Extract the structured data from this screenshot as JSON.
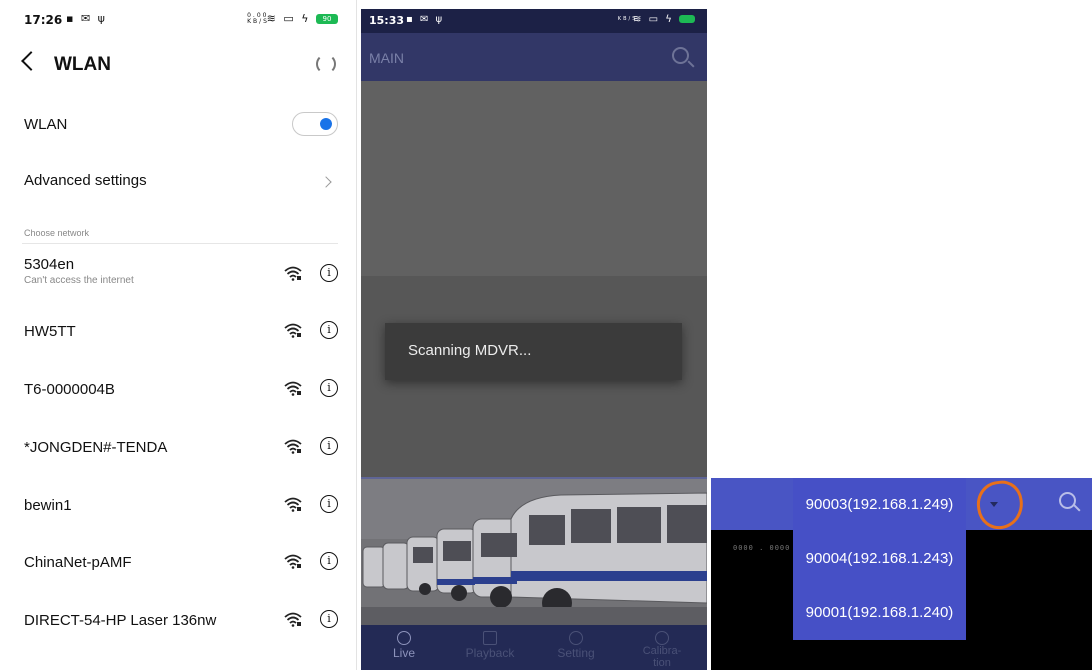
{
  "wlan_screen": {
    "status_bar": {
      "time": "17:26",
      "left_icons": "▪ ✉ ψ",
      "speed": "0.00 KB/S",
      "battery": "90"
    },
    "header": {
      "title": "WLAN"
    },
    "wlan_toggle": {
      "label": "WLAN",
      "state": "on"
    },
    "advanced": {
      "label": "Advanced settings"
    },
    "section_label": "Choose network",
    "networks": [
      {
        "name": "5304en",
        "status": "Can't access the internet"
      },
      {
        "name": "HW5TT",
        "status": ""
      },
      {
        "name": "T6-0000004B",
        "status": ""
      },
      {
        "name": "*JONGDEN#-TENDA",
        "status": ""
      },
      {
        "name": "bewin1",
        "status": ""
      },
      {
        "name": "ChinaNet-pAMF",
        "status": ""
      },
      {
        "name": "DIRECT-54-HP Laser 136nw",
        "status": ""
      }
    ]
  },
  "main_screen": {
    "status_bar": {
      "time": "15:33",
      "left_icons": "▪ ✉ ψ",
      "speed": "KB/S",
      "battery": ""
    },
    "appbar_title": "MAIN",
    "toast": "Scanning MDVR...",
    "nav": [
      {
        "label": "Live",
        "icon": "camera-icon"
      },
      {
        "label": "Playback",
        "icon": "image-icon"
      },
      {
        "label": "Setting",
        "icon": "gear-icon"
      },
      {
        "label": "Calibra- tion",
        "icon": "target-icon"
      }
    ]
  },
  "device_dropdown": {
    "options": [
      "90003(192.168.1.249)",
      "90004(192.168.1.243)",
      "90001(192.168.1.240)"
    ],
    "background_text": "0000 . 0000 ."
  },
  "colors": {
    "appbar": "#323767",
    "bottom_nav": "#232a55",
    "dropdown_bg": "#4650c6",
    "highlight_circle": "#e8701a",
    "toggle_on": "#1a73e8"
  }
}
